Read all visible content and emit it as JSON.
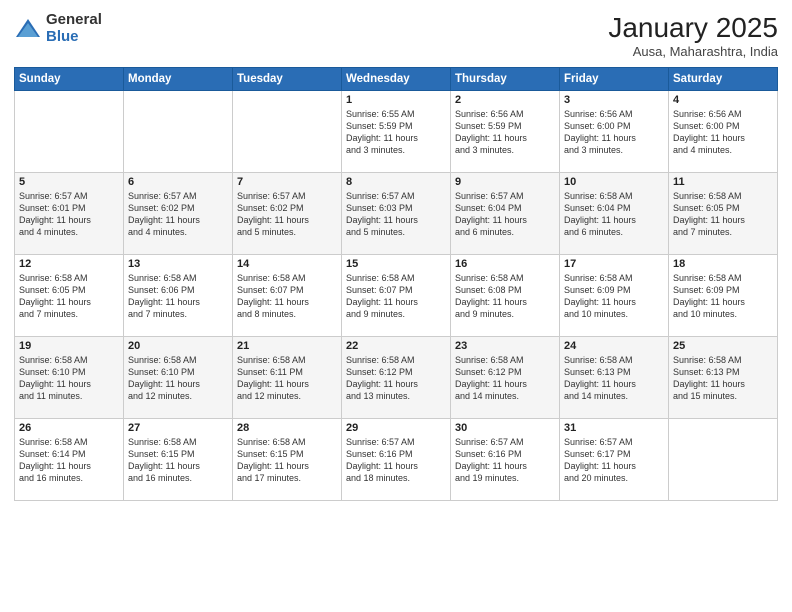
{
  "logo": {
    "general": "General",
    "blue": "Blue"
  },
  "header": {
    "month": "January 2025",
    "location": "Ausa, Maharashtra, India"
  },
  "days_of_week": [
    "Sunday",
    "Monday",
    "Tuesday",
    "Wednesday",
    "Thursday",
    "Friday",
    "Saturday"
  ],
  "weeks": [
    [
      {
        "day": "",
        "detail": ""
      },
      {
        "day": "",
        "detail": ""
      },
      {
        "day": "",
        "detail": ""
      },
      {
        "day": "1",
        "detail": "Sunrise: 6:55 AM\nSunset: 5:59 PM\nDaylight: 11 hours\nand 3 minutes."
      },
      {
        "day": "2",
        "detail": "Sunrise: 6:56 AM\nSunset: 5:59 PM\nDaylight: 11 hours\nand 3 minutes."
      },
      {
        "day": "3",
        "detail": "Sunrise: 6:56 AM\nSunset: 6:00 PM\nDaylight: 11 hours\nand 3 minutes."
      },
      {
        "day": "4",
        "detail": "Sunrise: 6:56 AM\nSunset: 6:00 PM\nDaylight: 11 hours\nand 4 minutes."
      }
    ],
    [
      {
        "day": "5",
        "detail": "Sunrise: 6:57 AM\nSunset: 6:01 PM\nDaylight: 11 hours\nand 4 minutes."
      },
      {
        "day": "6",
        "detail": "Sunrise: 6:57 AM\nSunset: 6:02 PM\nDaylight: 11 hours\nand 4 minutes."
      },
      {
        "day": "7",
        "detail": "Sunrise: 6:57 AM\nSunset: 6:02 PM\nDaylight: 11 hours\nand 5 minutes."
      },
      {
        "day": "8",
        "detail": "Sunrise: 6:57 AM\nSunset: 6:03 PM\nDaylight: 11 hours\nand 5 minutes."
      },
      {
        "day": "9",
        "detail": "Sunrise: 6:57 AM\nSunset: 6:04 PM\nDaylight: 11 hours\nand 6 minutes."
      },
      {
        "day": "10",
        "detail": "Sunrise: 6:58 AM\nSunset: 6:04 PM\nDaylight: 11 hours\nand 6 minutes."
      },
      {
        "day": "11",
        "detail": "Sunrise: 6:58 AM\nSunset: 6:05 PM\nDaylight: 11 hours\nand 7 minutes."
      }
    ],
    [
      {
        "day": "12",
        "detail": "Sunrise: 6:58 AM\nSunset: 6:05 PM\nDaylight: 11 hours\nand 7 minutes."
      },
      {
        "day": "13",
        "detail": "Sunrise: 6:58 AM\nSunset: 6:06 PM\nDaylight: 11 hours\nand 7 minutes."
      },
      {
        "day": "14",
        "detail": "Sunrise: 6:58 AM\nSunset: 6:07 PM\nDaylight: 11 hours\nand 8 minutes."
      },
      {
        "day": "15",
        "detail": "Sunrise: 6:58 AM\nSunset: 6:07 PM\nDaylight: 11 hours\nand 9 minutes."
      },
      {
        "day": "16",
        "detail": "Sunrise: 6:58 AM\nSunset: 6:08 PM\nDaylight: 11 hours\nand 9 minutes."
      },
      {
        "day": "17",
        "detail": "Sunrise: 6:58 AM\nSunset: 6:09 PM\nDaylight: 11 hours\nand 10 minutes."
      },
      {
        "day": "18",
        "detail": "Sunrise: 6:58 AM\nSunset: 6:09 PM\nDaylight: 11 hours\nand 10 minutes."
      }
    ],
    [
      {
        "day": "19",
        "detail": "Sunrise: 6:58 AM\nSunset: 6:10 PM\nDaylight: 11 hours\nand 11 minutes."
      },
      {
        "day": "20",
        "detail": "Sunrise: 6:58 AM\nSunset: 6:10 PM\nDaylight: 11 hours\nand 12 minutes."
      },
      {
        "day": "21",
        "detail": "Sunrise: 6:58 AM\nSunset: 6:11 PM\nDaylight: 11 hours\nand 12 minutes."
      },
      {
        "day": "22",
        "detail": "Sunrise: 6:58 AM\nSunset: 6:12 PM\nDaylight: 11 hours\nand 13 minutes."
      },
      {
        "day": "23",
        "detail": "Sunrise: 6:58 AM\nSunset: 6:12 PM\nDaylight: 11 hours\nand 14 minutes."
      },
      {
        "day": "24",
        "detail": "Sunrise: 6:58 AM\nSunset: 6:13 PM\nDaylight: 11 hours\nand 14 minutes."
      },
      {
        "day": "25",
        "detail": "Sunrise: 6:58 AM\nSunset: 6:13 PM\nDaylight: 11 hours\nand 15 minutes."
      }
    ],
    [
      {
        "day": "26",
        "detail": "Sunrise: 6:58 AM\nSunset: 6:14 PM\nDaylight: 11 hours\nand 16 minutes."
      },
      {
        "day": "27",
        "detail": "Sunrise: 6:58 AM\nSunset: 6:15 PM\nDaylight: 11 hours\nand 16 minutes."
      },
      {
        "day": "28",
        "detail": "Sunrise: 6:58 AM\nSunset: 6:15 PM\nDaylight: 11 hours\nand 17 minutes."
      },
      {
        "day": "29",
        "detail": "Sunrise: 6:57 AM\nSunset: 6:16 PM\nDaylight: 11 hours\nand 18 minutes."
      },
      {
        "day": "30",
        "detail": "Sunrise: 6:57 AM\nSunset: 6:16 PM\nDaylight: 11 hours\nand 19 minutes."
      },
      {
        "day": "31",
        "detail": "Sunrise: 6:57 AM\nSunset: 6:17 PM\nDaylight: 11 hours\nand 20 minutes."
      },
      {
        "day": "",
        "detail": ""
      }
    ]
  ]
}
